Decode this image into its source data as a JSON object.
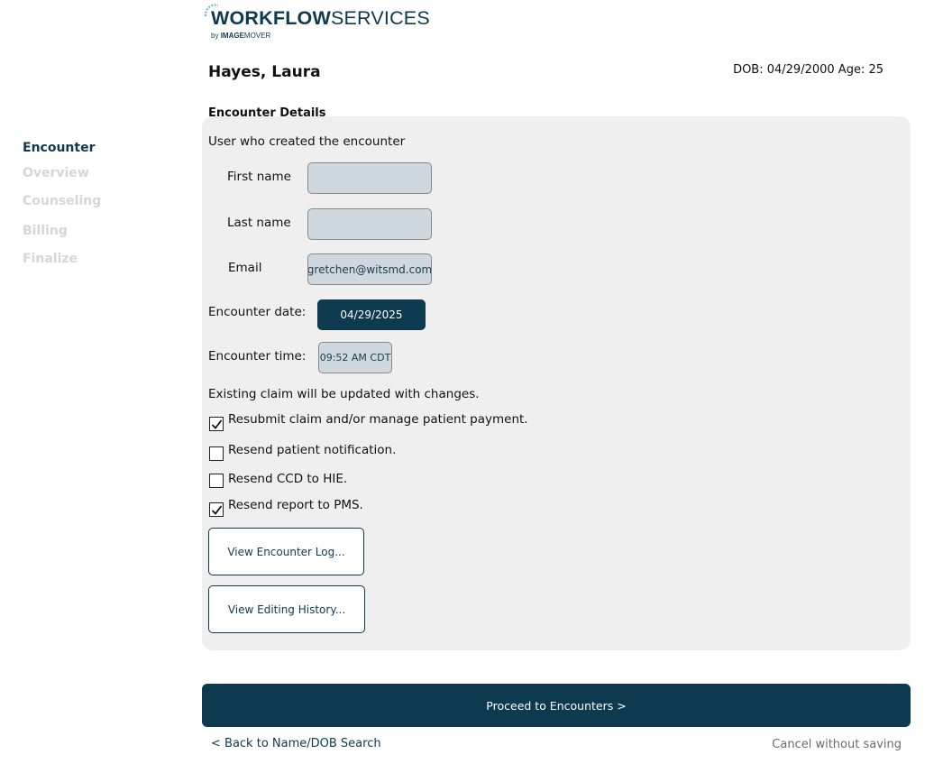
{
  "logo": {
    "workflow": "WORKFLOW",
    "services": "SERVICES",
    "by": "by",
    "imagemover_bold": "IMAGE",
    "imagemover_light": "MOVER"
  },
  "patient": {
    "name": "Hayes, Laura",
    "dob_age": "DOB: 04/29/2000 Age: 25"
  },
  "sidebar": {
    "items": [
      {
        "label": "Encounter",
        "active": true
      },
      {
        "label": "Overview",
        "active": false
      },
      {
        "label": "Counseling",
        "active": false
      },
      {
        "label": "Billing",
        "active": false
      },
      {
        "label": "Finalize",
        "active": false
      }
    ]
  },
  "encounter": {
    "section_title": "Encounter Details",
    "creator_heading": "User who created the encounter",
    "first_name_label": "First name",
    "first_name_value": "",
    "last_name_label": "Last name",
    "last_name_value": "",
    "email_label": "Email",
    "email_value": "gretchen@witsmd.com",
    "date_label": "Encounter date:",
    "date_value": "04/29/2025",
    "time_label": "Encounter time:",
    "time_value": "09:52 AM CDT",
    "claim_note": "Existing claim will be updated with changes.",
    "options": [
      {
        "label": "Resubmit claim and/or manage patient payment.",
        "checked": true
      },
      {
        "label": "Resend patient notification.",
        "checked": false
      },
      {
        "label": "Resend CCD to HIE.",
        "checked": false
      },
      {
        "label": "Resend report to PMS.",
        "checked": true
      }
    ],
    "view_log_label": "View Encounter Log...",
    "view_history_label": "View Editing History..."
  },
  "footer": {
    "proceed_label": "Proceed to Encounters >",
    "back_label": "< Back to Name/DOB Search",
    "cancel_label": "Cancel without saving"
  },
  "colors": {
    "brand": "#0e3a4f",
    "panel": "#efefef",
    "input_bg": "#cfd8df",
    "inactive_nav": "#d6d6d6"
  }
}
